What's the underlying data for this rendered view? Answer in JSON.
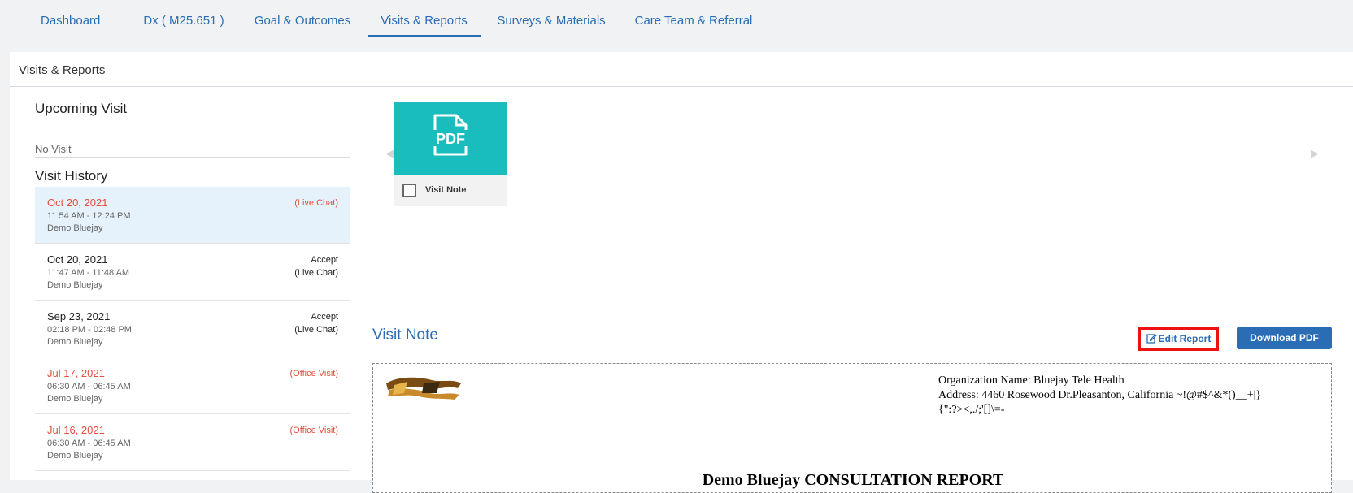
{
  "tabs": [
    {
      "label": "Dashboard"
    },
    {
      "label": "Dx ( M25.651 )"
    },
    {
      "label": "Goal & Outcomes"
    },
    {
      "label": "Visits & Reports"
    },
    {
      "label": "Surveys & Materials"
    },
    {
      "label": "Care Team & Referral"
    }
  ],
  "active_tab": "Visits & Reports",
  "panel": {
    "title": "Visits & Reports"
  },
  "upcoming": {
    "title": "Upcoming Visit",
    "empty_text": "No Visit"
  },
  "history": {
    "title": "Visit History",
    "visits": [
      {
        "date": "Oct 20, 2021",
        "time": "11:54 AM - 12:24 PM",
        "doctor": "Demo Bluejay",
        "status_line1": "",
        "status_line2": "(Live Chat)",
        "highlight": true,
        "red": true
      },
      {
        "date": "Oct 20, 2021",
        "time": "11:47 AM - 11:48 AM",
        "doctor": "Demo Bluejay",
        "status_line1": "Accept",
        "status_line2": "(Live Chat)",
        "highlight": false,
        "red": false
      },
      {
        "date": "Sep 23, 2021",
        "time": "02:18 PM - 02:48 PM",
        "doctor": "Demo Bluejay",
        "status_line1": "Accept",
        "status_line2": "(Live Chat)",
        "highlight": false,
        "red": false
      },
      {
        "date": "Jul 17, 2021",
        "time": "06:30 AM - 06:45 AM",
        "doctor": "Demo Bluejay",
        "status_line1": "",
        "status_line2": "(Office Visit)",
        "highlight": false,
        "red": true
      },
      {
        "date": "Jul 16, 2021",
        "time": "06:30 AM - 06:45 AM",
        "doctor": "Demo Bluejay",
        "status_line1": "",
        "status_line2": "(Office Visit)",
        "highlight": false,
        "red": true
      }
    ]
  },
  "document_tile": {
    "icon": "pdf-icon",
    "label": "Visit Note",
    "checked": false
  },
  "visit_note": {
    "title": "Visit Note",
    "edit_label": "Edit Report",
    "download_label": "Download PDF"
  },
  "report": {
    "org_line1": "Organization Name: Bluejay Tele Health",
    "org_line2": "Address: 4460 Rosewood Dr.Pleasanton, California ~!@#$^&*()__+|}",
    "org_line3": "{\":?><,./;'[]\\=-",
    "title": "Demo Bluejay CONSULTATION REPORT"
  },
  "colors": {
    "accent": "#2a6db5",
    "tile": "#19bdbd",
    "alert": "#e74c3c",
    "highlight_border": "#ee1111"
  }
}
